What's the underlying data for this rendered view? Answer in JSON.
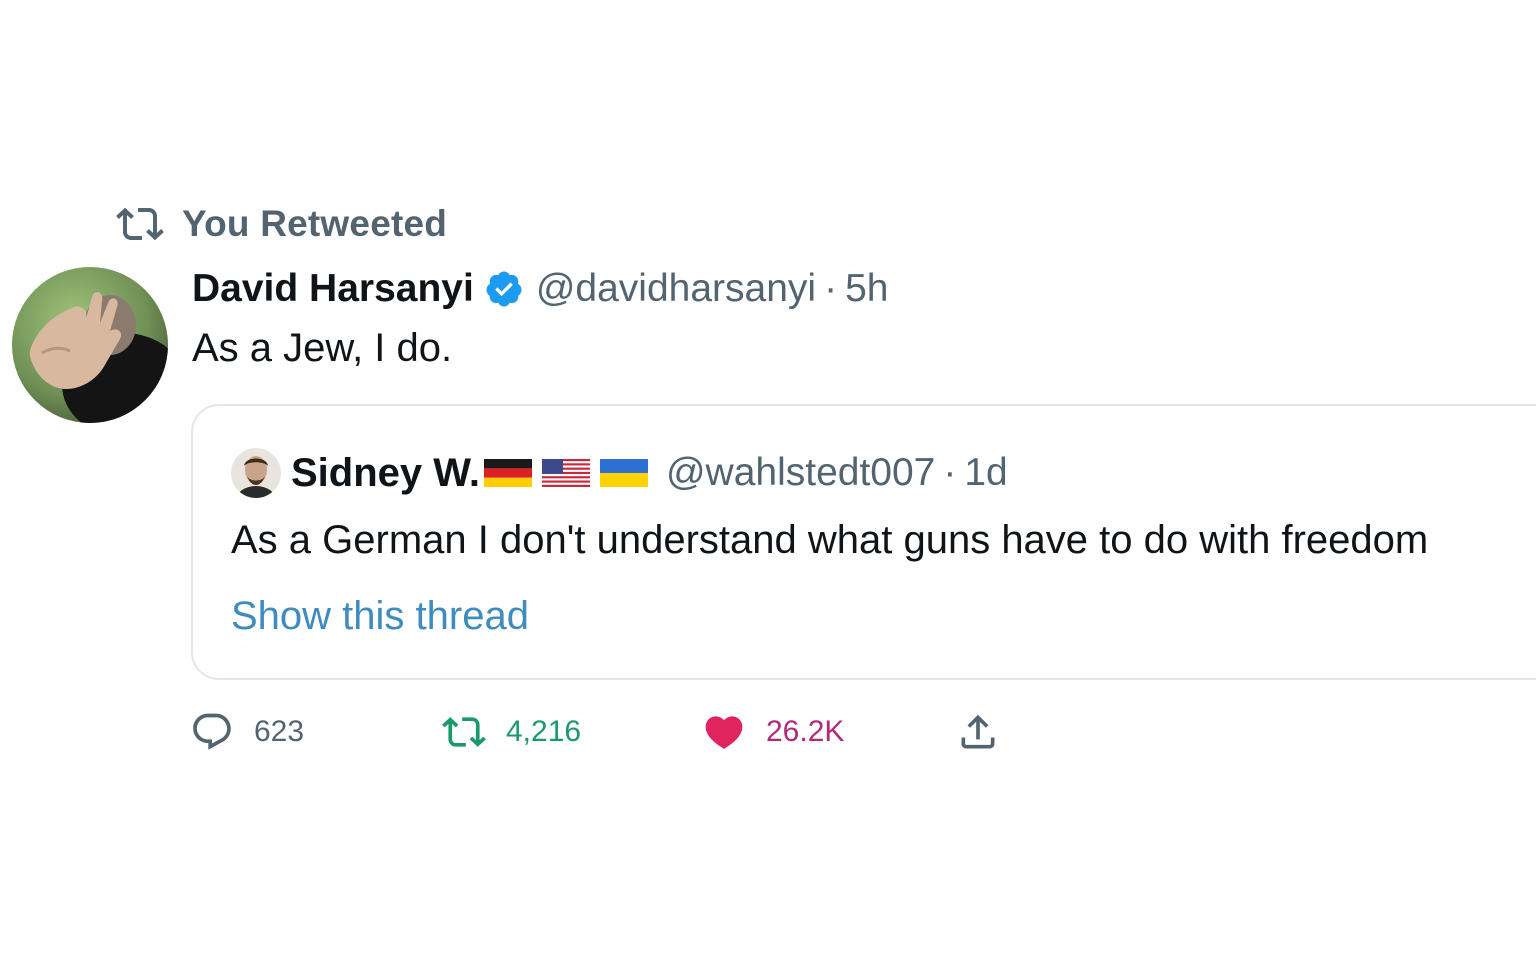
{
  "context": {
    "label": "You Retweeted",
    "icon": "retweet-icon"
  },
  "tweet": {
    "author_name": "David Harsanyi",
    "verified_icon": "verified-badge-icon",
    "handle": "@davidharsanyi",
    "separator": "·",
    "time": "5h",
    "text": "As a Jew, I do."
  },
  "quoted": {
    "author_name": "Sidney W.",
    "flags": [
      "flag-germany-icon",
      "flag-usa-icon",
      "flag-ukraine-icon"
    ],
    "handle": "@wahlstedt007",
    "separator": "·",
    "time": "1d",
    "text": "As a German I don't understand what guns have to do with freedom",
    "show_thread": "Show this thread"
  },
  "actions": {
    "reply_count": "623",
    "retweet_count": "4,216",
    "like_count": "26.2K"
  },
  "colors": {
    "text_primary": "#0f1419",
    "text_secondary": "#536471",
    "link_blue": "#3e8cbf",
    "verified_blue": "#1d9bf0",
    "retweet_green": "#1a9a6a",
    "like_pink": "#e0245e",
    "border": "#e3e7ea"
  }
}
